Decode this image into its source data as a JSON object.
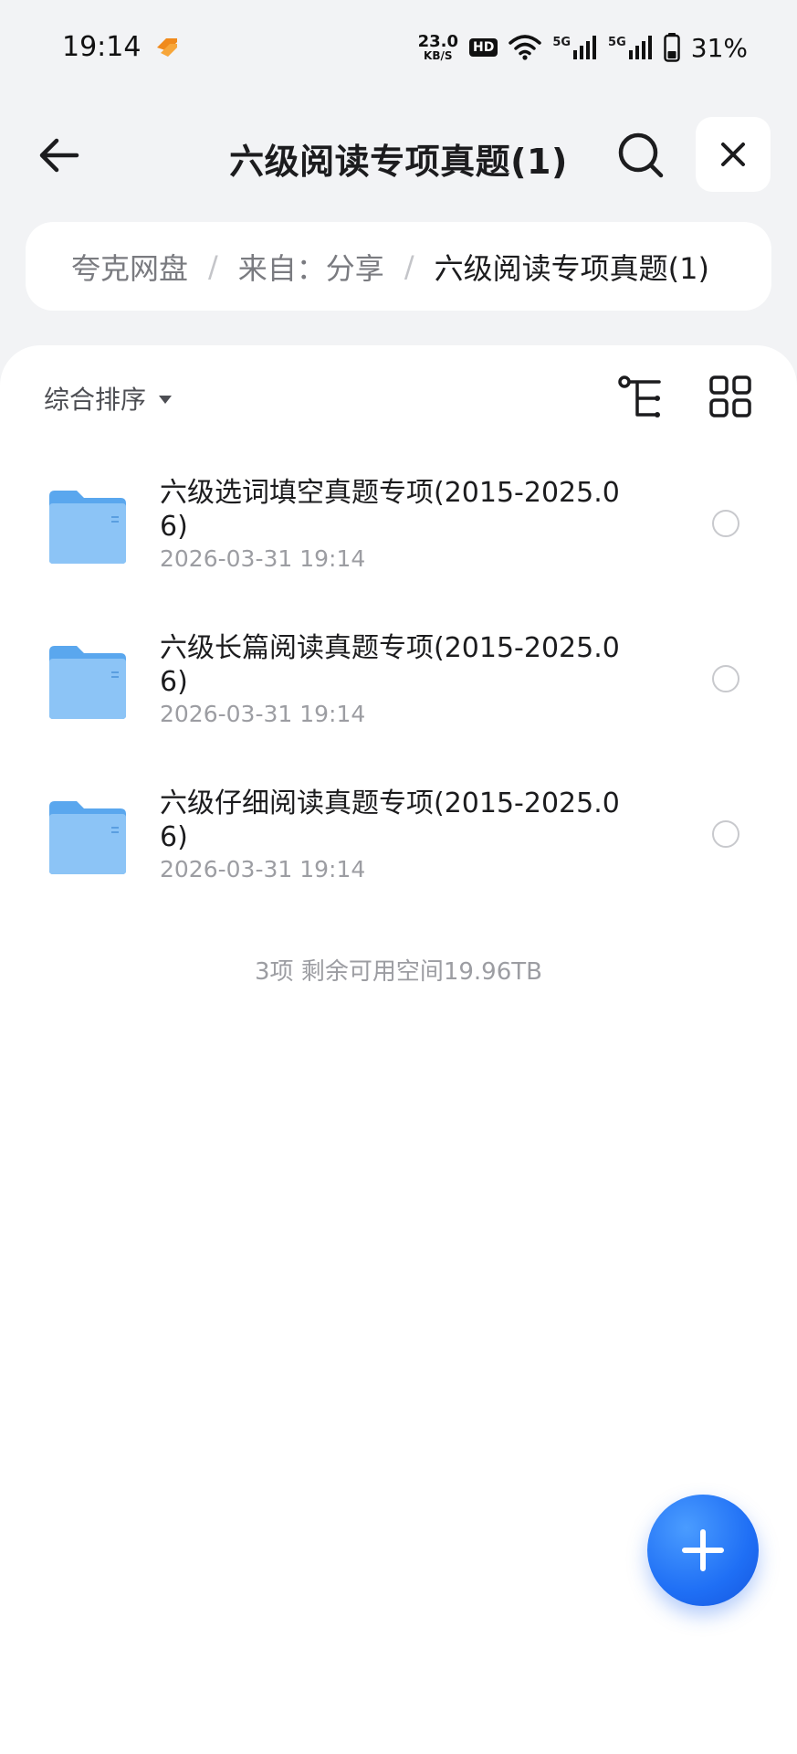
{
  "status_bar": {
    "time": "19:14",
    "net_speed_value": "23.0",
    "net_speed_unit": "KB/S",
    "hd_label": "HD",
    "signal_1_label": "5G",
    "signal_2_label": "5G",
    "battery_percent": "31%"
  },
  "header": {
    "title": "六级阅读专项真题(1)",
    "back_icon": "arrow-left-icon",
    "search_icon": "search-icon",
    "close_icon": "close-icon"
  },
  "breadcrumb": {
    "items": [
      "夸克网盘",
      "来自：分享",
      "六级阅读专项真题(1)"
    ],
    "separator": "/"
  },
  "toolbar": {
    "sort_label": "综合排序",
    "tree_icon": "tree-view-icon",
    "grid_icon": "grid-view-icon"
  },
  "files": [
    {
      "name": "六级选词填空真题专项(2015-2025.06)",
      "date": "2026-03-31 19:14",
      "type": "folder"
    },
    {
      "name": "六级长篇阅读真题专项(2015-2025.06)",
      "date": "2026-03-31 19:14",
      "type": "folder"
    },
    {
      "name": "六级仔细阅读真题专项(2015-2025.06)",
      "date": "2026-03-31 19:14",
      "type": "folder"
    }
  ],
  "summary": "3项 剩余可用空间19.96TB",
  "colors": {
    "accent": "#1f6ff5",
    "folder": "#7fbaf4",
    "background": "#f2f3f5"
  }
}
